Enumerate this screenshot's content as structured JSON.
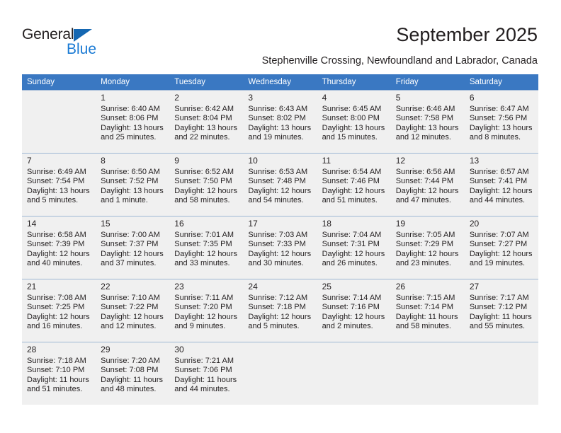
{
  "brand": {
    "name_part1": "General",
    "name_part2": "Blue",
    "triangle_color": "#1567b2",
    "blue_color": "#1a7ad4"
  },
  "header": {
    "title": "September 2025",
    "subtitle": "Stephenville Crossing, Newfoundland and Labrador, Canada"
  },
  "theme": {
    "header_bg": "#3a78c2",
    "header_text": "#ffffff",
    "cell_shade": "#f0f0f0",
    "grid_line": "#9eb7d4",
    "text": "#231f20"
  },
  "weekday_headers": [
    "Sunday",
    "Monday",
    "Tuesday",
    "Wednesday",
    "Thursday",
    "Friday",
    "Saturday"
  ],
  "weeks": [
    [
      {
        "day": "",
        "sunrise": "",
        "sunset": "",
        "daylight1": "",
        "daylight2": ""
      },
      {
        "day": "1",
        "sunrise": "Sunrise: 6:40 AM",
        "sunset": "Sunset: 8:06 PM",
        "daylight1": "Daylight: 13 hours",
        "daylight2": "and 25 minutes."
      },
      {
        "day": "2",
        "sunrise": "Sunrise: 6:42 AM",
        "sunset": "Sunset: 8:04 PM",
        "daylight1": "Daylight: 13 hours",
        "daylight2": "and 22 minutes."
      },
      {
        "day": "3",
        "sunrise": "Sunrise: 6:43 AM",
        "sunset": "Sunset: 8:02 PM",
        "daylight1": "Daylight: 13 hours",
        "daylight2": "and 19 minutes."
      },
      {
        "day": "4",
        "sunrise": "Sunrise: 6:45 AM",
        "sunset": "Sunset: 8:00 PM",
        "daylight1": "Daylight: 13 hours",
        "daylight2": "and 15 minutes."
      },
      {
        "day": "5",
        "sunrise": "Sunrise: 6:46 AM",
        "sunset": "Sunset: 7:58 PM",
        "daylight1": "Daylight: 13 hours",
        "daylight2": "and 12 minutes."
      },
      {
        "day": "6",
        "sunrise": "Sunrise: 6:47 AM",
        "sunset": "Sunset: 7:56 PM",
        "daylight1": "Daylight: 13 hours",
        "daylight2": "and 8 minutes."
      }
    ],
    [
      {
        "day": "7",
        "sunrise": "Sunrise: 6:49 AM",
        "sunset": "Sunset: 7:54 PM",
        "daylight1": "Daylight: 13 hours",
        "daylight2": "and 5 minutes."
      },
      {
        "day": "8",
        "sunrise": "Sunrise: 6:50 AM",
        "sunset": "Sunset: 7:52 PM",
        "daylight1": "Daylight: 13 hours",
        "daylight2": "and 1 minute."
      },
      {
        "day": "9",
        "sunrise": "Sunrise: 6:52 AM",
        "sunset": "Sunset: 7:50 PM",
        "daylight1": "Daylight: 12 hours",
        "daylight2": "and 58 minutes."
      },
      {
        "day": "10",
        "sunrise": "Sunrise: 6:53 AM",
        "sunset": "Sunset: 7:48 PM",
        "daylight1": "Daylight: 12 hours",
        "daylight2": "and 54 minutes."
      },
      {
        "day": "11",
        "sunrise": "Sunrise: 6:54 AM",
        "sunset": "Sunset: 7:46 PM",
        "daylight1": "Daylight: 12 hours",
        "daylight2": "and 51 minutes."
      },
      {
        "day": "12",
        "sunrise": "Sunrise: 6:56 AM",
        "sunset": "Sunset: 7:44 PM",
        "daylight1": "Daylight: 12 hours",
        "daylight2": "and 47 minutes."
      },
      {
        "day": "13",
        "sunrise": "Sunrise: 6:57 AM",
        "sunset": "Sunset: 7:41 PM",
        "daylight1": "Daylight: 12 hours",
        "daylight2": "and 44 minutes."
      }
    ],
    [
      {
        "day": "14",
        "sunrise": "Sunrise: 6:58 AM",
        "sunset": "Sunset: 7:39 PM",
        "daylight1": "Daylight: 12 hours",
        "daylight2": "and 40 minutes."
      },
      {
        "day": "15",
        "sunrise": "Sunrise: 7:00 AM",
        "sunset": "Sunset: 7:37 PM",
        "daylight1": "Daylight: 12 hours",
        "daylight2": "and 37 minutes."
      },
      {
        "day": "16",
        "sunrise": "Sunrise: 7:01 AM",
        "sunset": "Sunset: 7:35 PM",
        "daylight1": "Daylight: 12 hours",
        "daylight2": "and 33 minutes."
      },
      {
        "day": "17",
        "sunrise": "Sunrise: 7:03 AM",
        "sunset": "Sunset: 7:33 PM",
        "daylight1": "Daylight: 12 hours",
        "daylight2": "and 30 minutes."
      },
      {
        "day": "18",
        "sunrise": "Sunrise: 7:04 AM",
        "sunset": "Sunset: 7:31 PM",
        "daylight1": "Daylight: 12 hours",
        "daylight2": "and 26 minutes."
      },
      {
        "day": "19",
        "sunrise": "Sunrise: 7:05 AM",
        "sunset": "Sunset: 7:29 PM",
        "daylight1": "Daylight: 12 hours",
        "daylight2": "and 23 minutes."
      },
      {
        "day": "20",
        "sunrise": "Sunrise: 7:07 AM",
        "sunset": "Sunset: 7:27 PM",
        "daylight1": "Daylight: 12 hours",
        "daylight2": "and 19 minutes."
      }
    ],
    [
      {
        "day": "21",
        "sunrise": "Sunrise: 7:08 AM",
        "sunset": "Sunset: 7:25 PM",
        "daylight1": "Daylight: 12 hours",
        "daylight2": "and 16 minutes."
      },
      {
        "day": "22",
        "sunrise": "Sunrise: 7:10 AM",
        "sunset": "Sunset: 7:22 PM",
        "daylight1": "Daylight: 12 hours",
        "daylight2": "and 12 minutes."
      },
      {
        "day": "23",
        "sunrise": "Sunrise: 7:11 AM",
        "sunset": "Sunset: 7:20 PM",
        "daylight1": "Daylight: 12 hours",
        "daylight2": "and 9 minutes."
      },
      {
        "day": "24",
        "sunrise": "Sunrise: 7:12 AM",
        "sunset": "Sunset: 7:18 PM",
        "daylight1": "Daylight: 12 hours",
        "daylight2": "and 5 minutes."
      },
      {
        "day": "25",
        "sunrise": "Sunrise: 7:14 AM",
        "sunset": "Sunset: 7:16 PM",
        "daylight1": "Daylight: 12 hours",
        "daylight2": "and 2 minutes."
      },
      {
        "day": "26",
        "sunrise": "Sunrise: 7:15 AM",
        "sunset": "Sunset: 7:14 PM",
        "daylight1": "Daylight: 11 hours",
        "daylight2": "and 58 minutes."
      },
      {
        "day": "27",
        "sunrise": "Sunrise: 7:17 AM",
        "sunset": "Sunset: 7:12 PM",
        "daylight1": "Daylight: 11 hours",
        "daylight2": "and 55 minutes."
      }
    ],
    [
      {
        "day": "28",
        "sunrise": "Sunrise: 7:18 AM",
        "sunset": "Sunset: 7:10 PM",
        "daylight1": "Daylight: 11 hours",
        "daylight2": "and 51 minutes."
      },
      {
        "day": "29",
        "sunrise": "Sunrise: 7:20 AM",
        "sunset": "Sunset: 7:08 PM",
        "daylight1": "Daylight: 11 hours",
        "daylight2": "and 48 minutes."
      },
      {
        "day": "30",
        "sunrise": "Sunrise: 7:21 AM",
        "sunset": "Sunset: 7:06 PM",
        "daylight1": "Daylight: 11 hours",
        "daylight2": "and 44 minutes."
      },
      {
        "day": "",
        "sunrise": "",
        "sunset": "",
        "daylight1": "",
        "daylight2": ""
      },
      {
        "day": "",
        "sunrise": "",
        "sunset": "",
        "daylight1": "",
        "daylight2": ""
      },
      {
        "day": "",
        "sunrise": "",
        "sunset": "",
        "daylight1": "",
        "daylight2": ""
      },
      {
        "day": "",
        "sunrise": "",
        "sunset": "",
        "daylight1": "",
        "daylight2": ""
      }
    ]
  ]
}
